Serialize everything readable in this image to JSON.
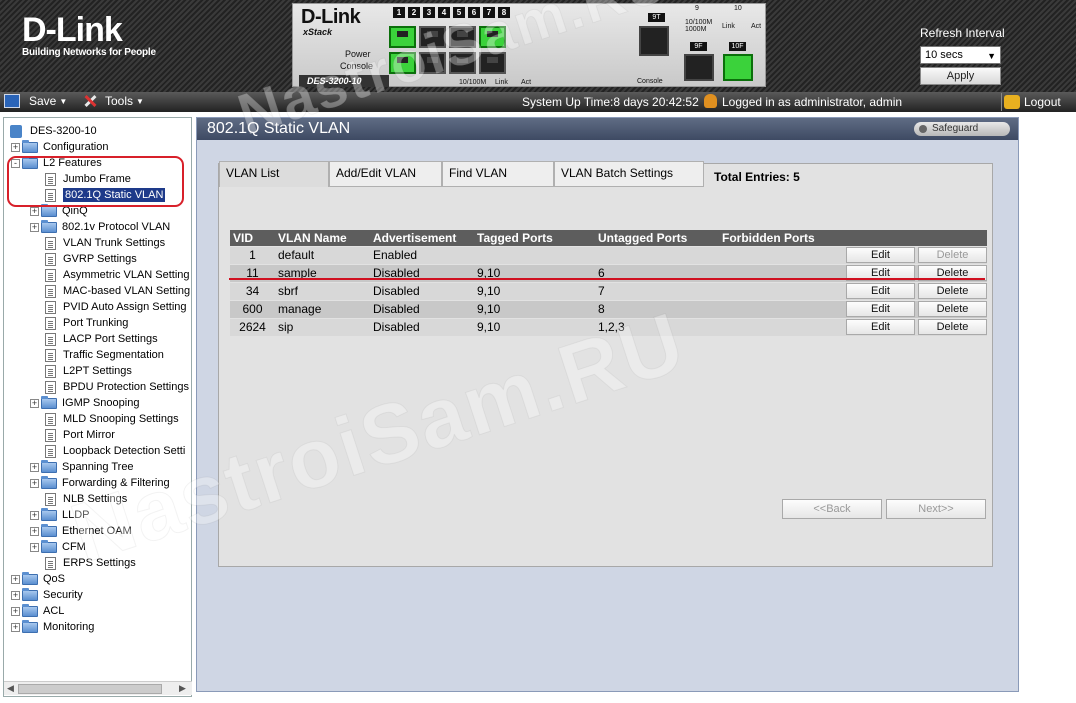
{
  "branding": {
    "logo": "D-Link",
    "tagline": "Building Networks for People"
  },
  "device": {
    "brand": "D-Link",
    "series": "xStack",
    "model": "DES-3200-10",
    "port_numbers": [
      "1",
      "2",
      "3",
      "4",
      "5",
      "6",
      "7",
      "8"
    ],
    "power_label": "Power",
    "console_label": "Console",
    "legend": "10/100M",
    "legend_link": "Link",
    "legend_act": "Act",
    "combo_label": "9T",
    "sfp_labels": [
      "9F",
      "10F"
    ],
    "combo_console": "Console",
    "top_nums": [
      "9",
      "10"
    ],
    "speed_label": "10/100M 1000M",
    "link_label": "Link",
    "act_label": "Act"
  },
  "refresh": {
    "label": "Refresh Interval",
    "selected": "10 secs",
    "apply": "Apply"
  },
  "toolbar": {
    "save": "Save",
    "tools": "Tools",
    "status": "System Up Time:8 days 20:42:52",
    "logged_in": "Logged in as administrator, admin",
    "logout": "Logout"
  },
  "tree": {
    "root": "DES-3200-10",
    "configuration": "Configuration",
    "l2_features": "L2 Features",
    "l2_children": [
      "Jumbo Frame",
      "802.1Q Static VLAN",
      "QinQ",
      "802.1v Protocol VLAN",
      "VLAN Trunk Settings",
      "GVRP Settings",
      "Asymmetric VLAN Setting",
      "MAC-based VLAN Setting",
      "PVID Auto Assign Setting",
      "Port Trunking",
      "LACP Port Settings",
      "Traffic Segmentation",
      "L2PT Settings",
      "BPDU Protection Settings",
      "IGMP Snooping",
      "MLD Snooping Settings",
      "Port Mirror",
      "Loopback Detection Setti",
      "Spanning Tree",
      "Forwarding & Filtering",
      "NLB Settings",
      "LLDP",
      "Ethernet OAM",
      "CFM",
      "ERPS Settings"
    ],
    "bottom": [
      "QoS",
      "Security",
      "ACL",
      "Monitoring"
    ]
  },
  "content": {
    "title": "802.1Q Static VLAN",
    "safeguard": "Safeguard",
    "tabs": [
      "VLAN List",
      "Add/Edit VLAN",
      "Find VLAN",
      "VLAN Batch Settings"
    ],
    "total_entries": "Total Entries: 5",
    "columns": [
      "VID",
      "VLAN Name",
      "Advertisement",
      "Tagged Ports",
      "Untagged Ports",
      "Forbidden Ports"
    ],
    "rows": [
      {
        "vid": "1",
        "name": "default",
        "adv": "Enabled",
        "tagged": "",
        "untagged": "",
        "forbidden": ""
      },
      {
        "vid": "11",
        "name": "sample",
        "adv": "Disabled",
        "tagged": "9,10",
        "untagged": "6",
        "forbidden": ""
      },
      {
        "vid": "34",
        "name": "sbrf",
        "adv": "Disabled",
        "tagged": "9,10",
        "untagged": "7",
        "forbidden": ""
      },
      {
        "vid": "600",
        "name": "manage",
        "adv": "Disabled",
        "tagged": "9,10",
        "untagged": "8",
        "forbidden": ""
      },
      {
        "vid": "2624",
        "name": "sip",
        "adv": "Disabled",
        "tagged": "9,10",
        "untagged": "1,2,3",
        "forbidden": ""
      }
    ],
    "edit": "Edit",
    "delete": "Delete",
    "back": "<<Back",
    "next": "Next>>"
  },
  "watermark": "NastroiSam.RU",
  "colors": {
    "accent": "#1e3a8a",
    "highlight": "#d8202a",
    "title_bar": "#4f5b74"
  }
}
